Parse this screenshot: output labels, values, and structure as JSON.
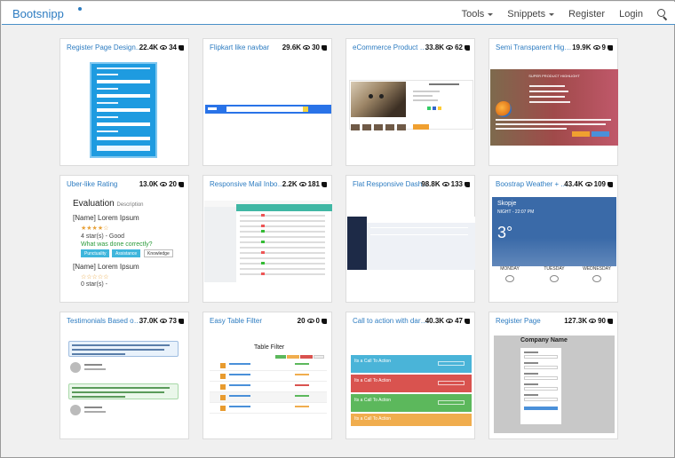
{
  "brand": "Bootsnipp",
  "nav": {
    "tools": "Tools",
    "snippets": "Snippets",
    "register": "Register",
    "login": "Login"
  },
  "cards": [
    {
      "title": "Register Page Design...",
      "views": "22.4K",
      "likes": "34"
    },
    {
      "title": "Flipkart like navbar",
      "views": "29.6K",
      "likes": "30"
    },
    {
      "title": "eCommerce Product D...",
      "views": "33.8K",
      "likes": "62"
    },
    {
      "title": "Semi Transparent Highli...",
      "views": "19.9K",
      "likes": "9"
    },
    {
      "title": "Uber-like Rating",
      "views": "13.0K",
      "likes": "20"
    },
    {
      "title": "Responsive Mail Inbox...",
      "views": "2.2K",
      "likes": "181"
    },
    {
      "title": "Flat Responsive Dash...",
      "views": "98.8K",
      "likes": "133"
    },
    {
      "title": "Boostrap Weather + ...",
      "views": "43.4K",
      "likes": "109"
    },
    {
      "title": "Testimonials Based on...",
      "views": "37.0K",
      "likes": "73"
    },
    {
      "title": "Easy Table Filter",
      "views": "20",
      "likes": "0"
    },
    {
      "title": "Call to action with dark...",
      "views": "40.3K",
      "likes": "47"
    },
    {
      "title": "Register Page",
      "views": "127.3K",
      "likes": "90"
    }
  ],
  "previews": {
    "rating": {
      "heading": "Evaluation",
      "subheading": "Description",
      "name1": "[Name] Lorem Ipsum",
      "stars1": "★★★★☆",
      "grade": "4 star(s) - Good",
      "question": "What was done correctly?",
      "tags": [
        "Punctuality",
        "Assistance",
        "Knowledge"
      ],
      "name2": "[Name] Lorem Ipsum",
      "stars2": "☆☆☆☆☆",
      "grade2": "0 star(s) -"
    },
    "weather": {
      "city": "Skopje",
      "time": "NIGHT - 22:07 PM",
      "temp": "3°",
      "days": [
        "MONDAY",
        "TUESDAY",
        "WEDNESDAY"
      ]
    },
    "table_filter": {
      "title": "Table Filter"
    },
    "register": {
      "company": "Company Name"
    },
    "calls": [
      "Its a Call To Action",
      "Its a Call To Action",
      "Its a Call To Action",
      "Its a Call To Action"
    ],
    "product_highlight": {
      "heading": "SUPER PRODUCT HIGHLIGHT"
    }
  },
  "colors": {
    "brand": "#2d7cc1",
    "card_border": "#dcdcdc",
    "page_bg": "#f0f0f0"
  }
}
